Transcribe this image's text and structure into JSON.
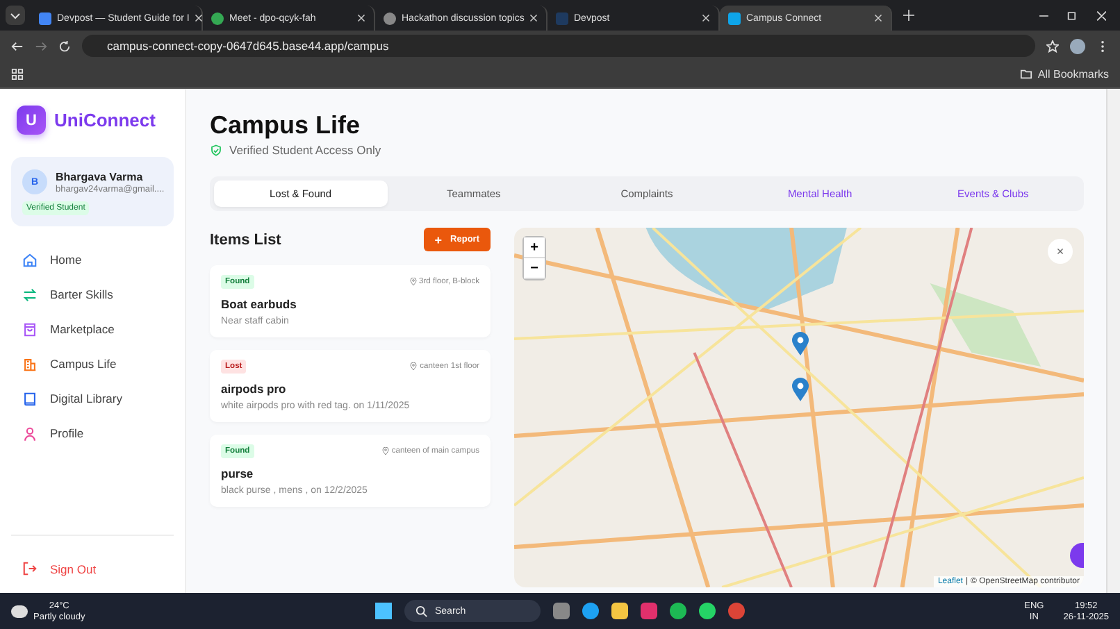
{
  "browser": {
    "tabs": [
      {
        "title": "Devpost — Student Guide for I",
        "selected": false
      },
      {
        "title": "Meet - dpo-qcyk-fah",
        "selected": false
      },
      {
        "title": "Hackathon discussion topics",
        "selected": false
      },
      {
        "title": "Devpost",
        "selected": false
      },
      {
        "title": "Campus Connect",
        "selected": true
      }
    ],
    "address": "campus-connect-copy-0647d645.base44.app/campus",
    "bookmarks": "All Bookmarks"
  },
  "sidebar": {
    "logo_letter": "U",
    "brand": "UniConnect",
    "user": {
      "initial": "B",
      "name": "Bhargava Varma",
      "email": "bhargav24varma@gmail....",
      "badge": "Verified Student"
    },
    "nav": [
      {
        "label": "Home",
        "color": "#3b82f6"
      },
      {
        "label": "Barter Skills",
        "color": "#10b981"
      },
      {
        "label": "Marketplace",
        "color": "#a855f7"
      },
      {
        "label": "Campus Life",
        "color": "#f97316"
      },
      {
        "label": "Digital Library",
        "color": "#2563eb"
      },
      {
        "label": "Profile",
        "color": "#ec4899"
      }
    ],
    "sign_out": "Sign Out"
  },
  "main": {
    "title": "Campus Life",
    "subtitle": "Verified Student Access Only",
    "tabs": [
      {
        "label": "Lost & Found",
        "selected": true,
        "accent": false
      },
      {
        "label": "Teammates",
        "selected": false,
        "accent": false
      },
      {
        "label": "Complaints",
        "selected": false,
        "accent": false
      },
      {
        "label": "Mental Health",
        "selected": false,
        "accent": true
      },
      {
        "label": "Events & Clubs",
        "selected": false,
        "accent": true
      }
    ],
    "items_title": "Items List",
    "report_button": "Report",
    "report_icon": "+",
    "items": [
      {
        "status": "Found",
        "kind": "found",
        "location": "3rd floor, B-block",
        "name": "Boat earbuds",
        "description": "Near staff cabin"
      },
      {
        "status": "Lost",
        "kind": "lost",
        "location": "canteen 1st floor",
        "name": "airpods pro",
        "description": "white airpods pro with red tag. on 1/11/2025"
      },
      {
        "status": "Found",
        "kind": "found",
        "location": "canteen of main campus",
        "name": "purse",
        "description": "black purse , mens , on 12/2/2025"
      }
    ],
    "map": {
      "zoom_in": "+",
      "zoom_out": "−",
      "close": "×",
      "attribution_link": "Leaflet",
      "separator": "|",
      "attribution": "© OpenStreetMap contributor"
    }
  },
  "taskbar": {
    "temperature": "24°C",
    "weather": "Partly cloudy",
    "search": "Search",
    "lang": "ENG",
    "region": "IN",
    "time": "19:52",
    "date": "26-11-2025"
  }
}
